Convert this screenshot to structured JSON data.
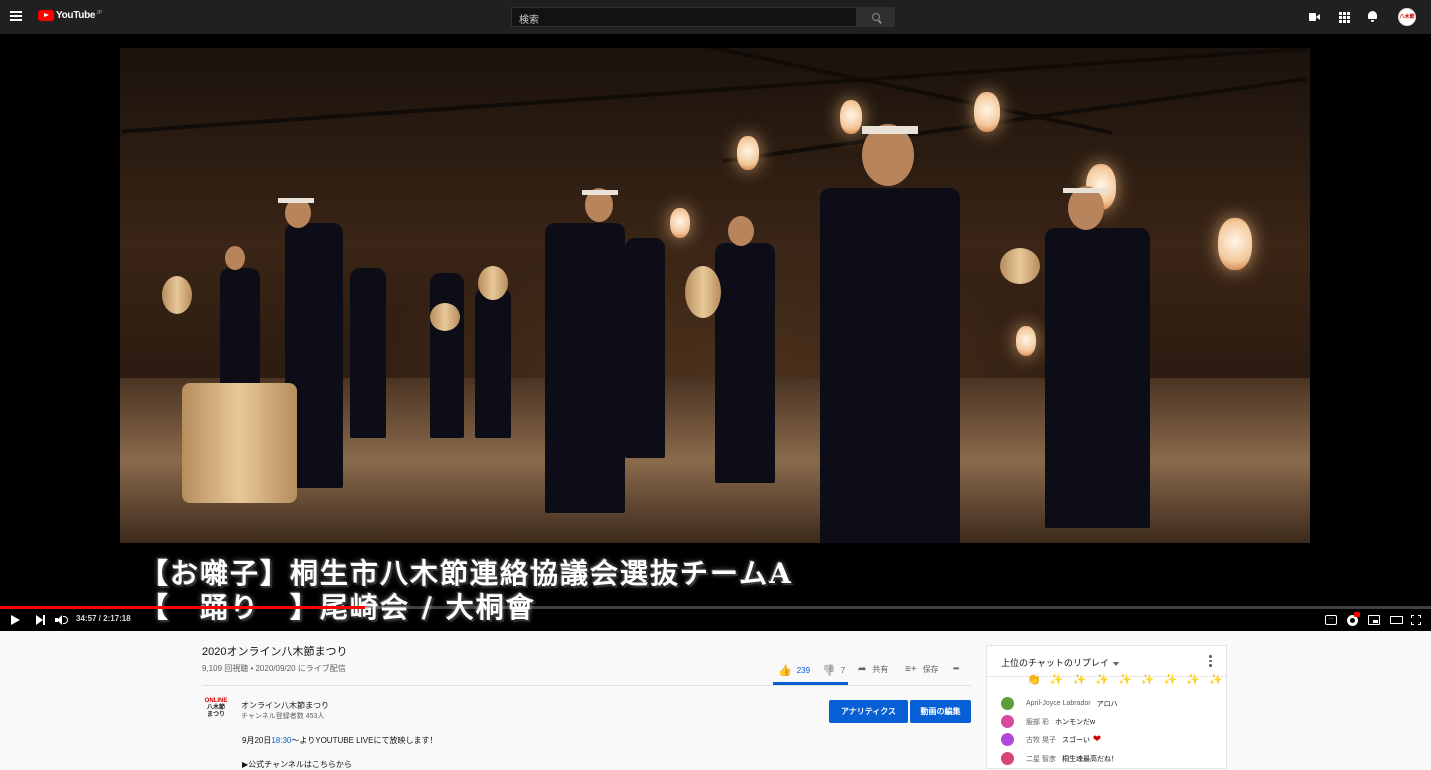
{
  "header": {
    "logo_text": "YouTube",
    "logo_region": "JP",
    "search_placeholder": "検索",
    "avatar_text": "八木節"
  },
  "player": {
    "caption_line1": "【お囃子】桐生市八木節連絡協議会選抜チームA",
    "caption_line2": "【　踊り　】尾崎会 / 大桐會",
    "time": "34:57 / 2:17:18",
    "progress_fraction": 0.255
  },
  "video": {
    "title": "2020オンライン八木節まつり",
    "views_date": "9,109 回視聴 • 2020/09/20 にライブ配信",
    "like_count": "239",
    "dislike_count": "7",
    "share_label": "共有",
    "save_label": "保存",
    "more_label": "•••"
  },
  "channel": {
    "logo_line1": "ONLINE",
    "logo_line2": "八木節",
    "logo_line3": "まつり",
    "name": "オンライン八木節まつり",
    "subscribers": "チャンネル登録者数 453人",
    "analytics_button": "アナリティクス",
    "edit_button": "動画の編集"
  },
  "description": {
    "line1_prefix": "9月20日",
    "line1_link": "18:30",
    "line1_suffix": "〜よりYOUTUBE LIVEにて放映します！",
    "line2": "▶公式チャンネルはこちらから"
  },
  "chat": {
    "header": "上位のチャットのリプレイ",
    "emoji_row": "👏 ✨ ✨ ✨ ✨ ✨ ✨ ✨ ✨ ✨",
    "messages": [
      {
        "author": "April-Joyce Labrador",
        "text": "アロハ",
        "avatar_color": "#5a9e3c"
      },
      {
        "author": "服部 彩",
        "text": "ホンモンだw",
        "avatar_color": "#d84aa0"
      },
      {
        "author": "古牧 晃子",
        "text": "スゴーい",
        "avatar_color": "#b04ad8"
      },
      {
        "author": "二星 智彦",
        "text": "桐生魂最高だね！",
        "avatar_color": "#d8437a"
      }
    ]
  },
  "colors": {
    "brand_red": "#ff0000",
    "accent_blue": "#065fd4",
    "topbar_bg": "#202020"
  }
}
